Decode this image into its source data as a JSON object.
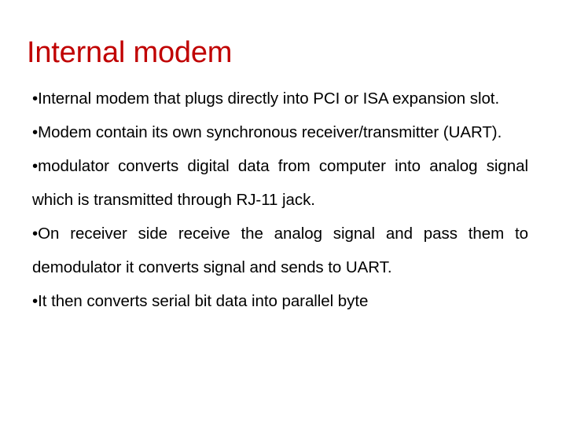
{
  "slide": {
    "title": "Internal modem",
    "title_color": "#c00000",
    "body_color": "#000000",
    "background_color": "#ffffff",
    "bullet_glyph": "•",
    "bullets": [
      {
        "marker": "•",
        "text": "Internal modem that plugs directly into PCI or ISA expansion slot.",
        "justified": true
      },
      {
        "marker": "•",
        "text": "Modem contain its own synchronous receiver/transmitter (UART).",
        "justified": true
      },
      {
        "marker": "•",
        "text": "modulator converts digital data from computer into analog signal which is transmitted through RJ-11 jack.",
        "justified": true
      },
      {
        "marker": "•",
        "text": "On receiver side receive the analog signal and pass them to demodulator it converts signal and sends to UART.",
        "justified": true
      },
      {
        "marker": "•",
        "text": "It then converts serial bit data into parallel byte",
        "justified": false
      }
    ]
  }
}
